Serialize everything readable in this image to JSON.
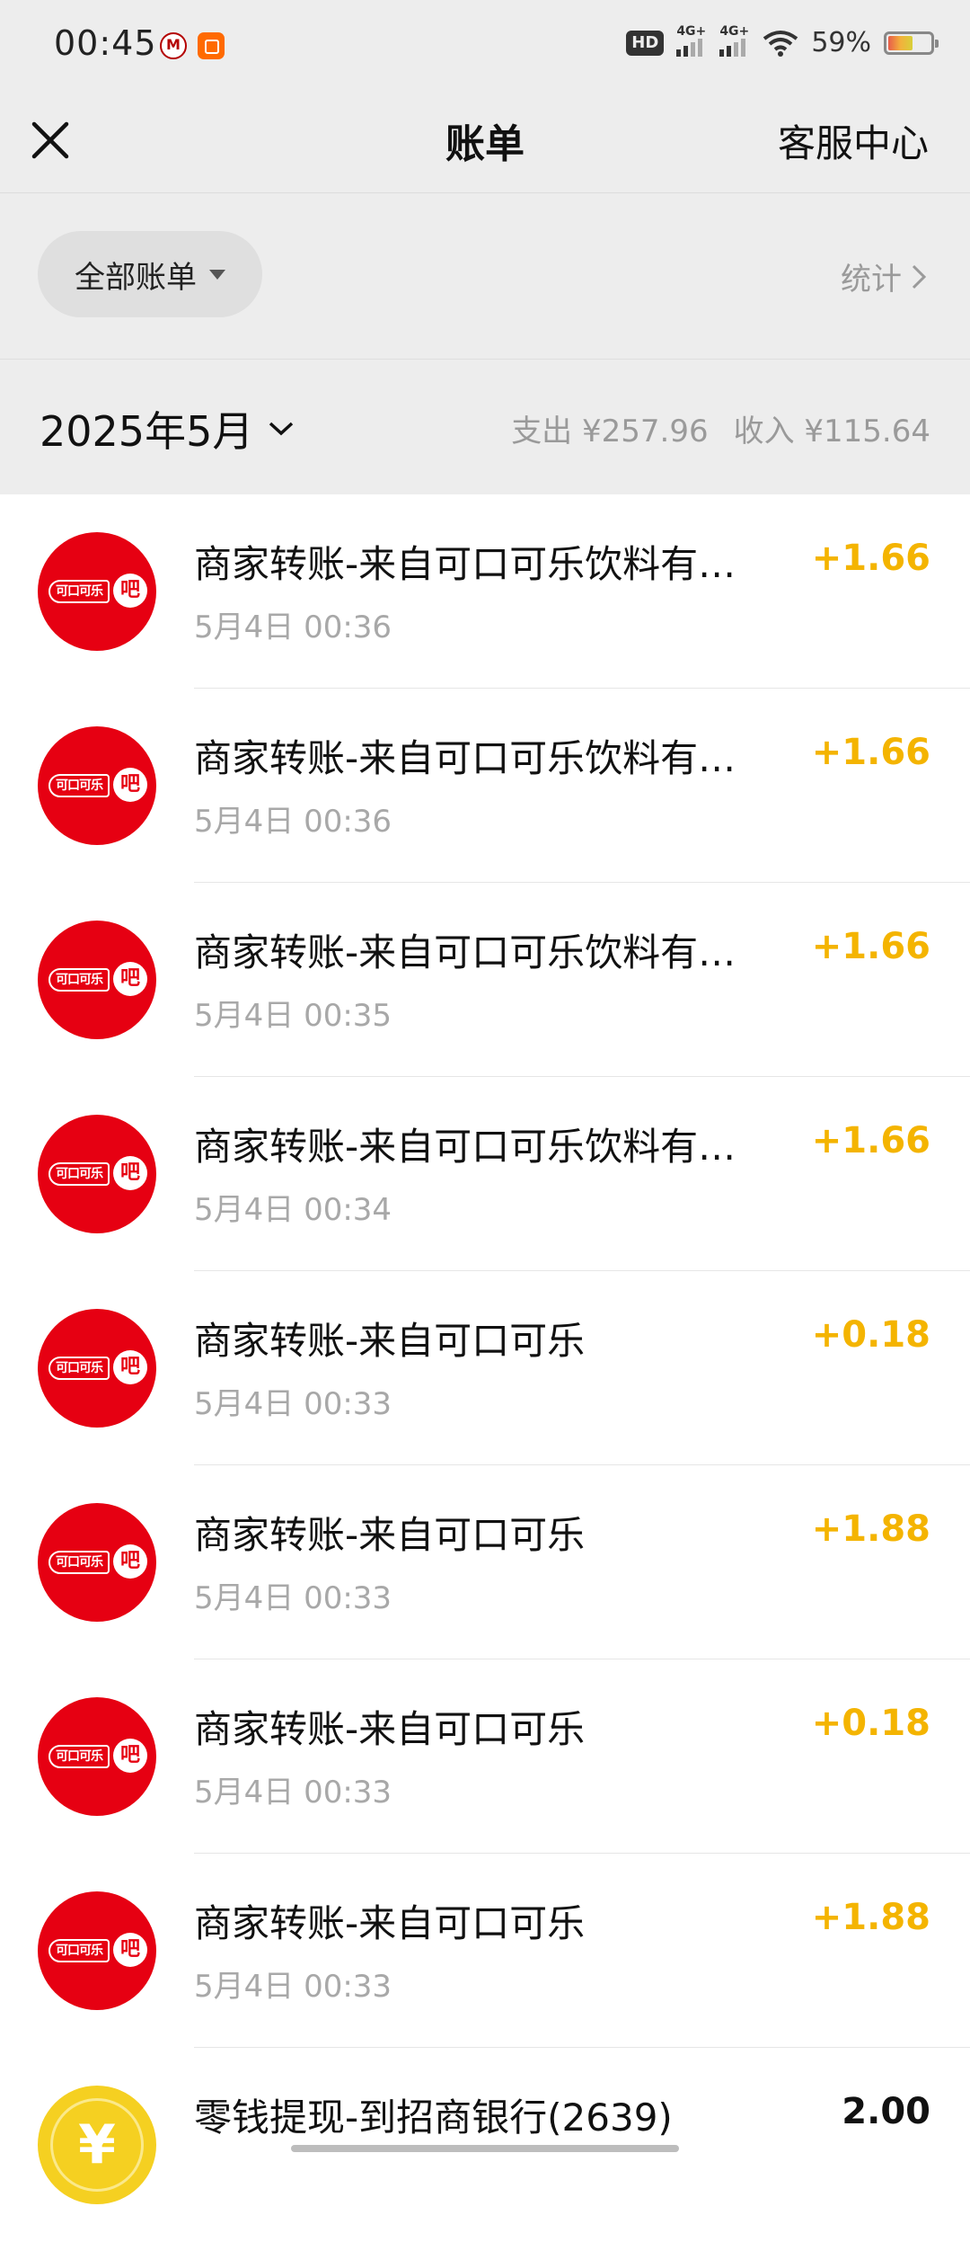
{
  "status_bar": {
    "time": "00:45",
    "battery_text": "59%",
    "battery_level": 0.59,
    "hd_label": "HD",
    "net_label_1": "4G+",
    "net_label_2": "4G+"
  },
  "nav": {
    "title": "账单",
    "right_link": "客服中心",
    "close_icon": "close-icon"
  },
  "filter": {
    "label": "全部账单",
    "stats_link": "统计"
  },
  "month": {
    "label": "2025年5月",
    "expense": "支出 ¥257.96",
    "income": "收入 ¥115.64"
  },
  "colors": {
    "income_amount": "#f4b400",
    "avatar_red": "#e60012",
    "coin_yellow": "#f5d021",
    "background_gray": "#ededed"
  },
  "avatar_text": {
    "brand": "可口可乐",
    "ba": "吧",
    "coin": "¥"
  },
  "bills": [
    {
      "title": "商家转账-来自可口可乐饮料有限公司",
      "time": "5月4日 00:36",
      "amount": "+1.66"
    },
    {
      "title": "商家转账-来自可口可乐饮料有限公司",
      "time": "5月4日 00:36",
      "amount": "+1.66"
    },
    {
      "title": "商家转账-来自可口可乐饮料有限公司",
      "time": "5月4日 00:35",
      "amount": "+1.66"
    },
    {
      "title": "商家转账-来自可口可乐饮料有限公司",
      "time": "5月4日 00:34",
      "amount": "+1.66"
    },
    {
      "title": "商家转账-来自可口可乐",
      "time": "5月4日 00:33",
      "amount": "+0.18"
    },
    {
      "title": "商家转账-来自可口可乐",
      "time": "5月4日 00:33",
      "amount": "+1.88"
    },
    {
      "title": "商家转账-来自可口可乐",
      "time": "5月4日 00:33",
      "amount": "+0.18"
    },
    {
      "title": "商家转账-来自可口可乐",
      "time": "5月4日 00:33",
      "amount": "+1.88"
    }
  ],
  "withdrawal": {
    "title": "零钱提现-到招商银行(2639)",
    "amount": "2.00"
  }
}
